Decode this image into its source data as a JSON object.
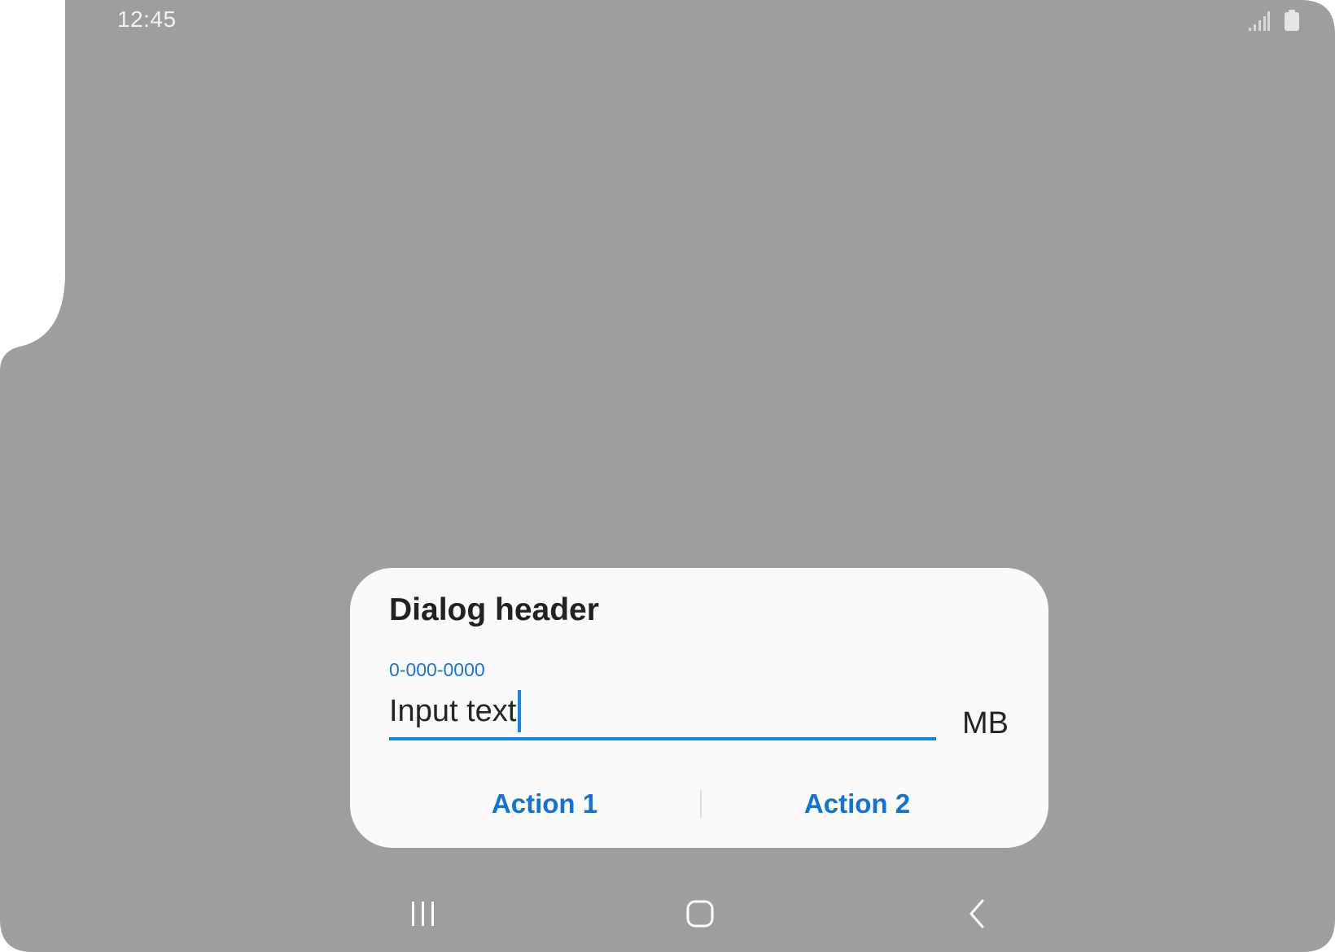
{
  "status_bar": {
    "time": "12:45",
    "icons": [
      "signal-icon",
      "battery-icon"
    ]
  },
  "dialog": {
    "title": "Dialog header",
    "field": {
      "label": "0-000-0000",
      "value": "Input text",
      "unit": "MB"
    },
    "actions": [
      {
        "label": "Action 1"
      },
      {
        "label": "Action 2"
      }
    ]
  },
  "nav_bar": {
    "icons": [
      "recents-icon",
      "home-icon",
      "back-icon"
    ]
  },
  "colors": {
    "scrim": "#9e9e9e",
    "dialog_bg": "#fafafa",
    "accent": "#1583e9",
    "action_text": "#1373d3",
    "primary_text": "#222222"
  }
}
